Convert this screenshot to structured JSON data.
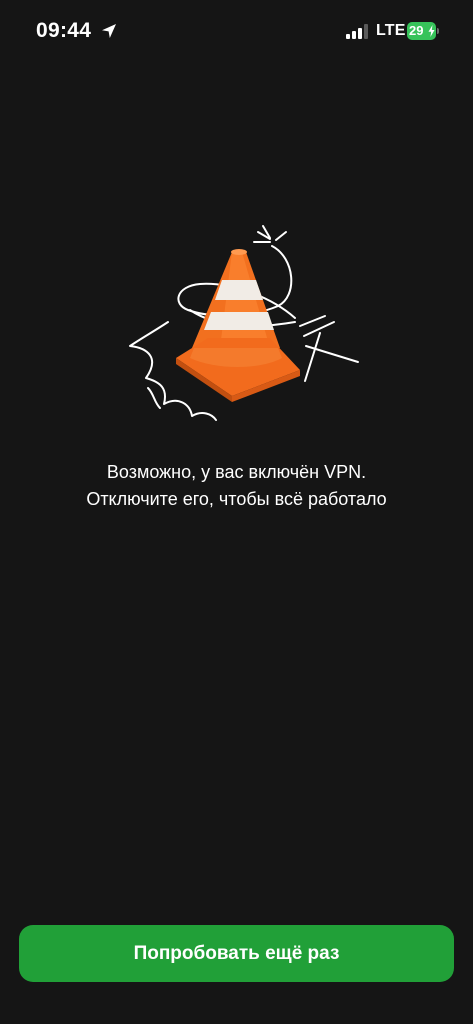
{
  "status_bar": {
    "time": "09:44",
    "network": "LTE",
    "battery_level": "29",
    "icons": [
      "location-arrow-icon",
      "cellular-signal-icon",
      "battery-charging-icon"
    ]
  },
  "illustration": {
    "icon": "traffic-cone-icon"
  },
  "message": {
    "line1": "Возможно, у вас включён VPN.",
    "line2": "Отключите его, чтобы всё работало"
  },
  "actions": {
    "retry_label": "Попробовать ещё раз"
  },
  "colors": {
    "background": "#151515",
    "accent": "#21a038",
    "battery": "#37c35a",
    "cone": "#f26b1d"
  }
}
